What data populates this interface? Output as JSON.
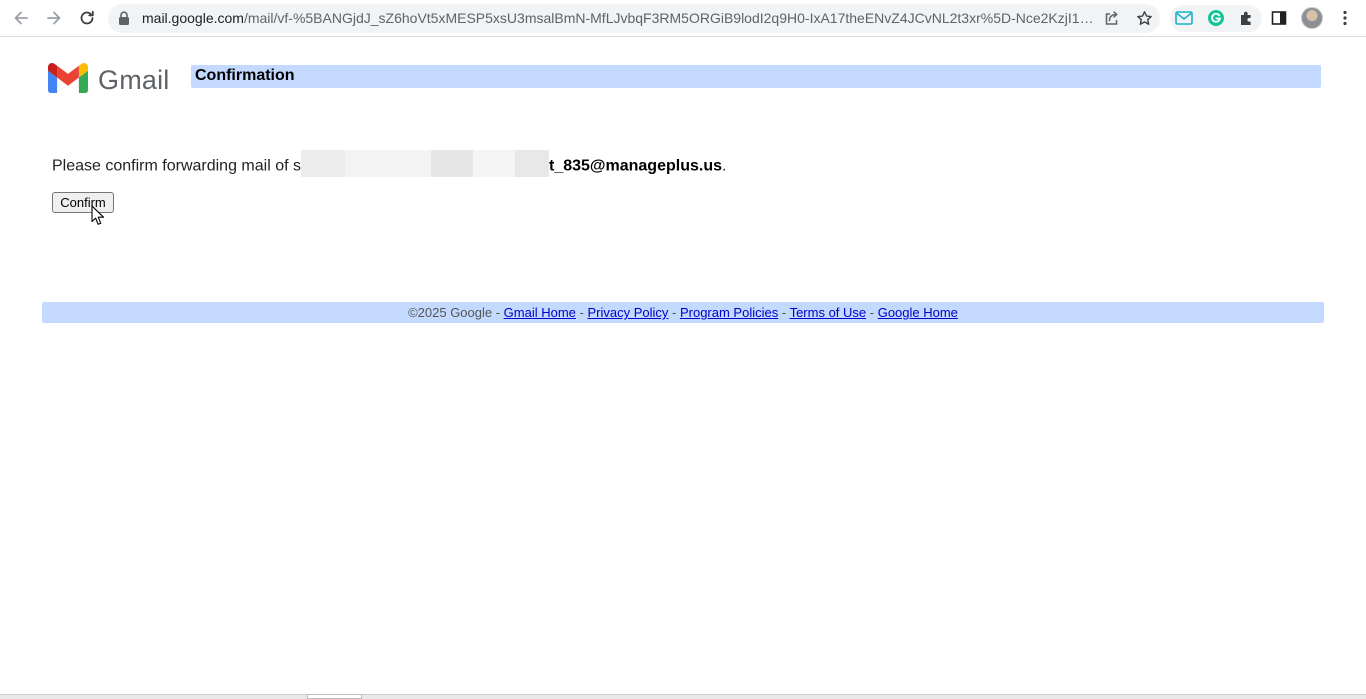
{
  "browser": {
    "url_host": "mail.google.com",
    "url_path": "/mail/vf-%5BANGjdJ_sZ6hoVt5xMESP5xsU3msalBmN-MfLJvbqF3RM5ORGiB9lodI2q9H0-IxA17theENvZ4JCvNL2t3xr%5D-Nce2KzjI1A4Y0...",
    "icons": [
      "back-icon",
      "forward-icon",
      "reload-icon",
      "lock-icon",
      "share-icon",
      "bookmark-star-icon",
      "mail-extension-icon",
      "grammarly-icon",
      "puzzle-extensions-icon",
      "side-panel-icon",
      "profile-avatar",
      "kebab-menu-icon"
    ]
  },
  "header": {
    "logo_text": "Gmail",
    "title": "Confirmation"
  },
  "main": {
    "message_prefix": "Please confirm forwarding mail of ",
    "email_partial_lead": "s",
    "email_visible_suffix": "t_835@manageplus.us",
    "message_suffix": ".",
    "confirm_label": "Confirm"
  },
  "footer": {
    "copyright": "©2025 Google",
    "sep": " - ",
    "links": [
      "Gmail Home",
      "Privacy Policy",
      "Program Policies",
      "Terms of Use",
      "Google Home"
    ]
  },
  "colors": {
    "bar_blue": "#c3d9ff",
    "link": "#0000cc",
    "gmail_red": "#ea4335",
    "gmail_blue": "#4285f4",
    "gmail_green": "#34a853",
    "gmail_yellow": "#fbbc04"
  }
}
